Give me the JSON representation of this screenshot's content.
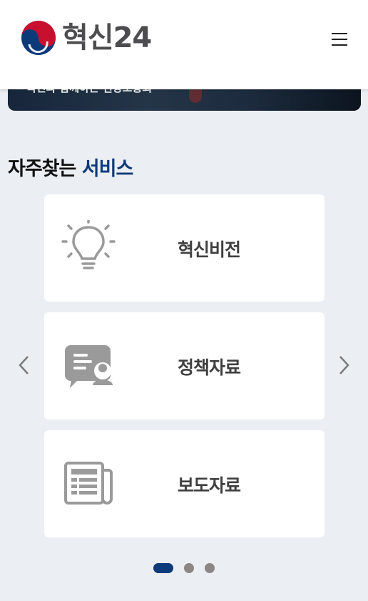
{
  "header": {
    "logo_text": "혁신24",
    "menu_icon": "hamburger-menu-icon"
  },
  "banner": {
    "caption": "국민과 함께하는 현장소통회"
  },
  "section": {
    "title_plain": "자주찾는",
    "title_accent": "서비스"
  },
  "services": [
    {
      "label": "혁신비전",
      "icon": "lightbulb-icon"
    },
    {
      "label": "정책자료",
      "icon": "policy-document-icon"
    },
    {
      "label": "보도자료",
      "icon": "newspaper-icon"
    }
  ],
  "carousel": {
    "prev_icon": "chevron-left-icon",
    "next_icon": "chevron-right-icon",
    "page_count": 3,
    "active_page": 1
  },
  "colors": {
    "accent": "#0d3a7a",
    "background": "#ebeef2",
    "card": "#ffffff",
    "icon_gray": "#999999",
    "dot_inactive": "#8c8684"
  }
}
